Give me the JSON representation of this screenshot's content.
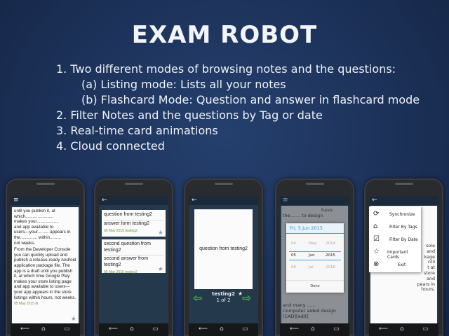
{
  "title": "EXAM ROBOT",
  "features": [
    "1. Two different modes of browsing notes and the questions:",
    "(a) Listing mode: Lists all your notes",
    "(b) Flashcard Mode: Question and answer in flashcard mode",
    "2. Filter Notes and the questions by Tag or date",
    "3. Real-time card animations",
    "4. Cloud connected"
  ],
  "phone1": {
    "lines": [
      "until you publish it, at",
      "which.......................",
      "makes your..................",
      "and app available to",
      "users—your......... appears in",
      "the.............. within.........",
      "not weeks.",
      "From the Developer Console you can quickly upload and publish a release-ready Android application package file. The app is a draft until you publish it, at which time Google Play makes your store listing page and app available to users—your app appears in the store listings within hours, not weeks."
    ],
    "date": "05 May 2015",
    "tag": "dt"
  },
  "phone2": {
    "items": [
      {
        "q": "question from testing2",
        "a": "answer form testing2",
        "date": "05 May 2015",
        "tag": "testing2"
      },
      {
        "q": "second question from testing2",
        "a": "second answer from testing2",
        "date": "05 May 2015",
        "tag": "testing2"
      }
    ]
  },
  "phone3": {
    "card_text": "question from testing2",
    "tag": "testing2",
    "counter": "1 of 2"
  },
  "phone4": {
    "header": "Fri, 5 Jun 2015",
    "days": [
      "04",
      "05",
      "06"
    ],
    "months": [
      "May",
      "Jun",
      "Jul"
    ],
    "years": [
      "2014",
      "2015",
      "2016"
    ],
    "done": "Done",
    "bg_top": "have",
    "bg_lines": [
      "the....... to design",
      "and many ......",
      "Computer aided design [CAD][edit]"
    ]
  },
  "phone5": {
    "menu": [
      "Synchronize",
      "Filter By Tags",
      "Filter By Date",
      "Important Cards",
      "Exit"
    ],
    "bg_lines": [
      "sole",
      "and",
      "kage",
      "ntil",
      "t at",
      "store",
      "and",
      "pears in",
      "hours,"
    ]
  },
  "nav": {
    "back": "⟵",
    "home": "⌂",
    "recent": "▭"
  }
}
